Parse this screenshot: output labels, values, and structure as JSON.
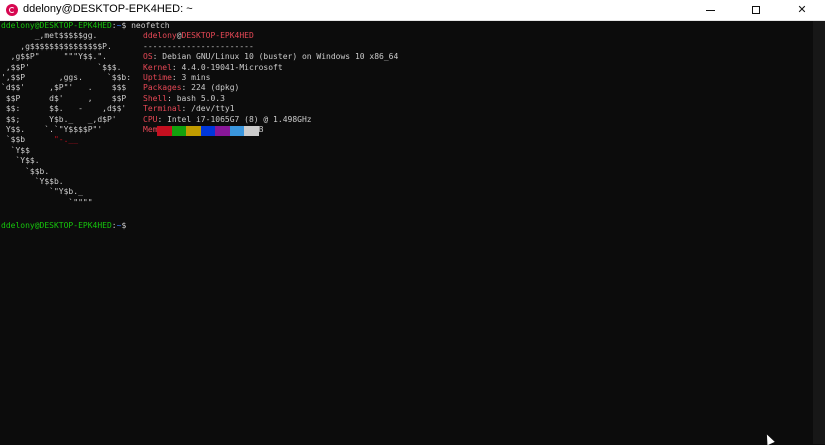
{
  "window": {
    "title": "ddelony@DESKTOP-EPK4HED: ~",
    "minimize_icon": "minimize-icon",
    "maximize_icon": "maximize-icon",
    "close_glyph": "✕"
  },
  "prompt1": {
    "user": "ddelony@DESKTOP-EPK4HED",
    "sep": ":",
    "path": "~",
    "dollar": "$ ",
    "command": "neofetch"
  },
  "logo": [
    "       _,met$$$$$gg.",
    "    ,g$$$$$$$$$$$$$$$P.",
    "  ,g$$P\"     \"\"\"Y$$.\".",
    " ,$$P'              `$$$.",
    "',$$P       ,ggs.     `$$b:",
    "`d$$'     ,$P\"'   .    $$$",
    " $$P      d$'     ,    $$P",
    " $$:      $$.   -    ,d$$'",
    " $$;      Y$b._   _,d$P'",
    " Y$$.    `.`\"Y$$$$P\"'",
    " `$$b      \"-.__",
    "  `Y$$",
    "   `Y$$.",
    "     `$$b.",
    "       `Y$$b.",
    "          `\"Y$b._",
    "              `\"\"\"\""
  ],
  "info": {
    "header_user": "ddelony",
    "header_at": "@",
    "header_host": "DESKTOP-EPK4HED",
    "divider": "-----------------------",
    "fields": [
      {
        "key": "OS",
        "value": "Debian GNU/Linux 10 (buster) on Windows 10 x86_64"
      },
      {
        "key": "Kernel",
        "value": "4.4.0-19041-Microsoft"
      },
      {
        "key": "Uptime",
        "value": "3 mins"
      },
      {
        "key": "Packages",
        "value": "224 (dpkg)"
      },
      {
        "key": "Shell",
        "value": "bash 5.0.3"
      },
      {
        "key": "Terminal",
        "value": "/dev/tty1"
      },
      {
        "key": "CPU",
        "value": "Intel i7-1065G7 (8) @ 1.498GHz"
      },
      {
        "key": "Memory",
        "value": "6781MiB / 7959MiB"
      }
    ]
  },
  "swatches": [
    "#c50f1f",
    "#13a10e",
    "#c19c00",
    "#0037da",
    "#881798",
    "#3a96dd",
    "#cccccc"
  ],
  "prompt2": {
    "user": "ddelony@DESKTOP-EPK4HED",
    "sep": ":",
    "path": "~",
    "dollar": "$"
  },
  "colors": {
    "background": "#0c0c0c",
    "user_green": "#16c60c",
    "path_blue": "#3b78ff",
    "info_red": "#e74856",
    "logo_red": "#c50f1f",
    "foreground": "#cccccc"
  }
}
